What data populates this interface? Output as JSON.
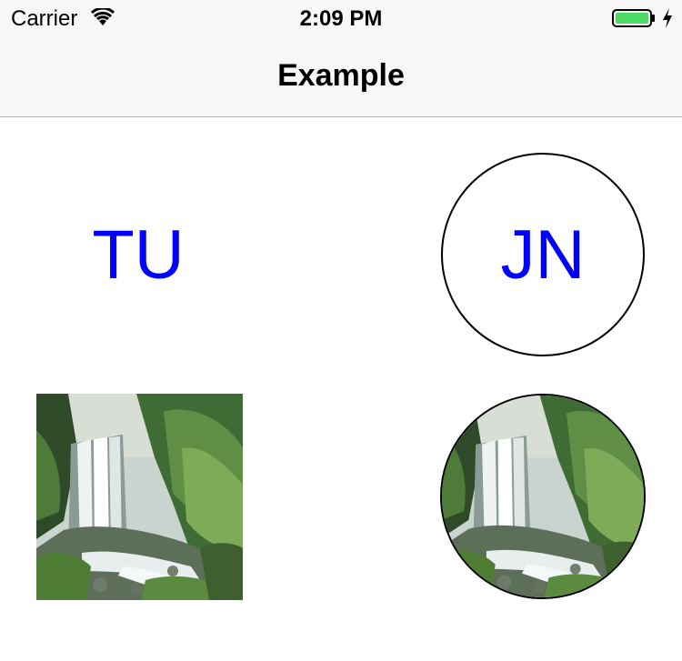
{
  "status_bar": {
    "carrier": "Carrier",
    "time": "2:09 PM",
    "battery_color": "#4cd964"
  },
  "nav": {
    "title": "Example"
  },
  "avatars": {
    "plain_initials": "TU",
    "circle_initials": "JN",
    "initials_color": "#0000ff"
  },
  "images": {
    "square_icon": "waterfall-photo",
    "circle_icon": "waterfall-photo"
  }
}
